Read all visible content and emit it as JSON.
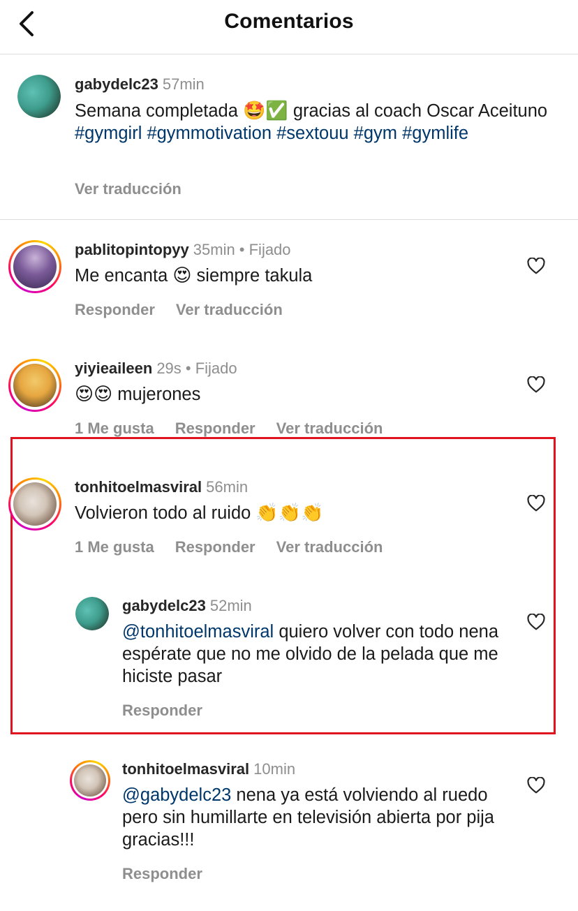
{
  "header": {
    "title": "Comentarios"
  },
  "caption": {
    "username": "gabydelc23",
    "time": "57min",
    "text_before": "Semana completada ",
    "emojis": "🤩✅",
    "text_after": " gracias al coach Oscar Aceituno ",
    "hashtags": "#gymgirl #gymmotivation #sextouu #gym #gymlife",
    "translate": "Ver traducción"
  },
  "comments": [
    {
      "username": "pablitopintopyy",
      "meta": "35min • Fijado",
      "text_before": "Me encanta ",
      "emojis": "😍",
      "text_after": "  siempre takula",
      "actions": [
        "Responder",
        "Ver traducción"
      ]
    },
    {
      "username": "yiyieaileen",
      "meta": "29s • Fijado",
      "emojis": "😍😍",
      "text_after": " mujerones",
      "actions": [
        "1 Me gusta",
        "Responder",
        "Ver traducción"
      ]
    },
    {
      "username": "tonhitoelmasviral",
      "meta": "56min",
      "text_before": "Volvieron todo al ruido ",
      "emojis": "👏👏👏",
      "actions": [
        "1 Me gusta",
        "Responder",
        "Ver traducción"
      ]
    }
  ],
  "replies": [
    {
      "username": "gabydelc23",
      "meta": "52min",
      "mention": "@tonhitoelmasviral",
      "text": " quiero volver con todo nena espérate que no me olvido de la pelada que me hiciste pasar",
      "actions": [
        "Responder"
      ]
    },
    {
      "username": "tonhitoelmasviral",
      "meta": "10min",
      "mention": "@gabydelc23",
      "text": " nena ya está volviendo al ruedo pero sin humillarte en televisión abierta por pija gracias!!!",
      "actions": [
        "Responder"
      ]
    }
  ],
  "colors": {
    "highlight": "#e0141e",
    "link": "#00376b",
    "muted": "#8e8e8e"
  },
  "icons": [
    "chevron-left-icon",
    "heart-outline-icon"
  ]
}
